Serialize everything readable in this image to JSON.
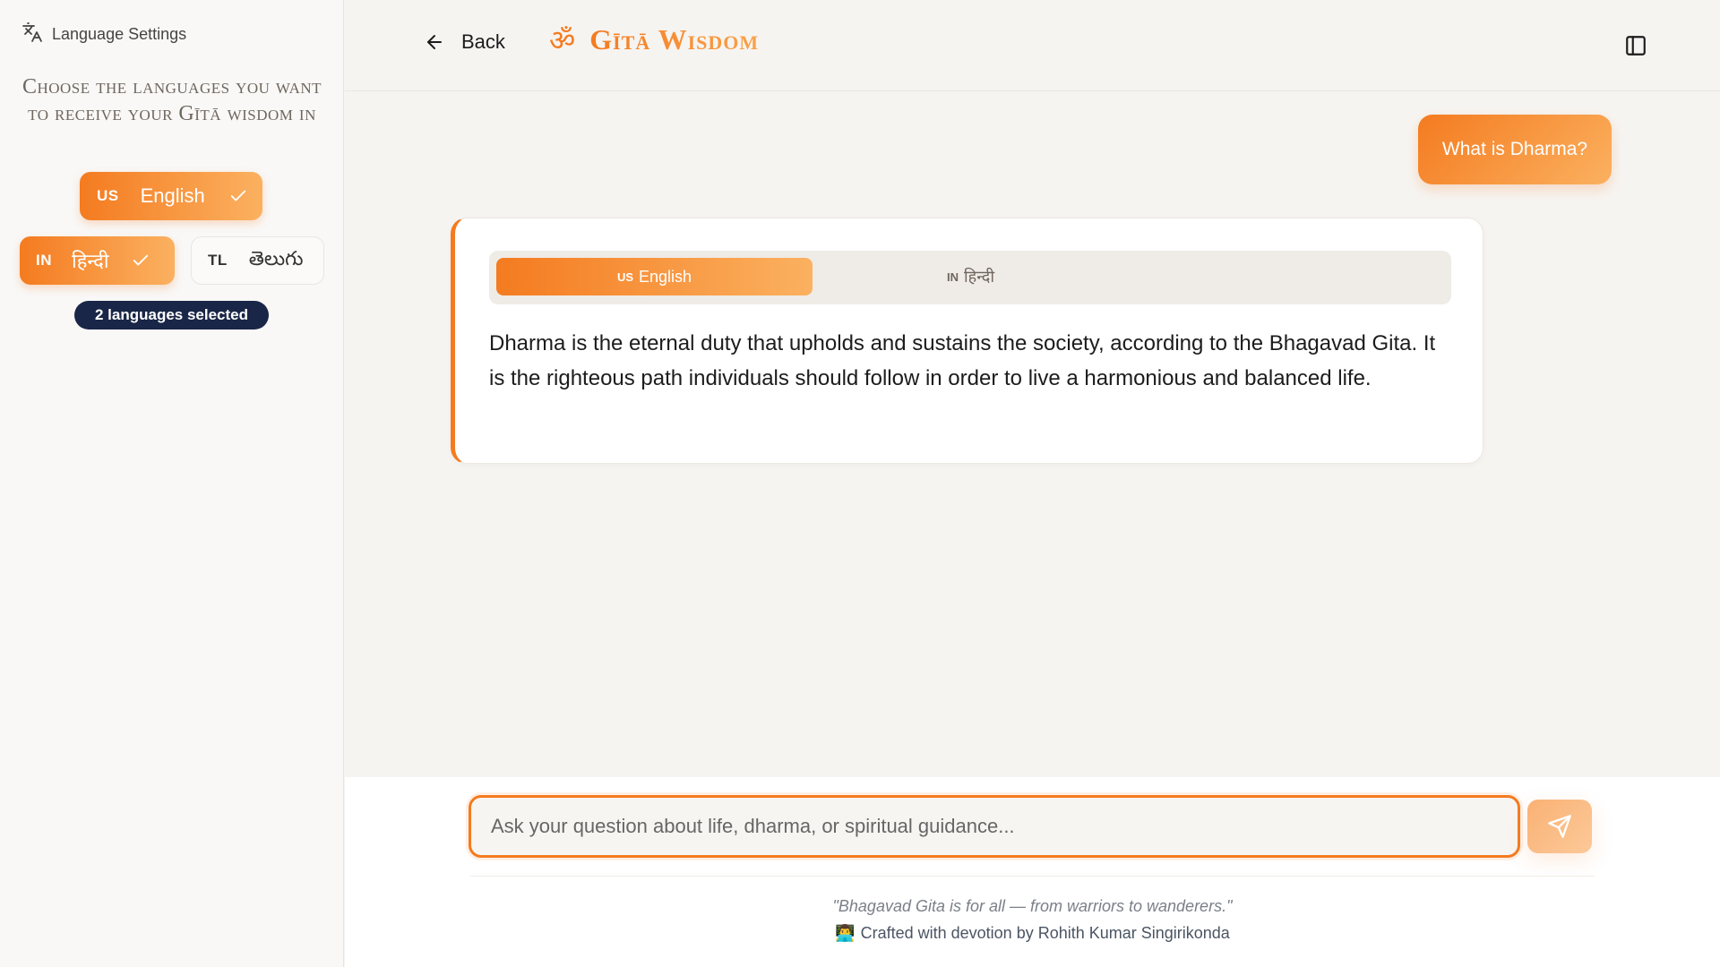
{
  "sidebar": {
    "heading": "Language Settings",
    "title": "Choose the languages you want to receive your Gītā wisdom in",
    "languages": [
      {
        "code": "US",
        "name": "English",
        "selected": true
      },
      {
        "code": "IN",
        "name": "हिन्दी",
        "selected": true
      },
      {
        "code": "TL",
        "name": "తెలుగు",
        "selected": false
      }
    ],
    "selected_count": "2 languages selected"
  },
  "header": {
    "back_label": "Back",
    "brand_symbol": "ॐ",
    "brand_title": "Gītā Wisdom"
  },
  "chat": {
    "user_message": "What is Dharma?",
    "answer": {
      "tabs": [
        {
          "code": "US",
          "label": "English",
          "active": true
        },
        {
          "code": "IN",
          "label": "हिन्दी",
          "active": false
        }
      ],
      "text": "Dharma is the eternal duty that upholds and sustains the society, according to the Bhagavad Gita. It is the righteous path individuals should follow in order to live a harmonious and balanced life."
    }
  },
  "composer": {
    "placeholder": "Ask your question about life, dharma, or spiritual guidance...",
    "value": ""
  },
  "footer": {
    "quote": "\"Bhagavad Gita is for all — from warriors to wanderers.\"",
    "credit_emoji": "👨‍💻",
    "credit": "Crafted with devotion by Rohith Kumar Singirikonda"
  },
  "colors": {
    "accent": "#f47b20",
    "accent_light": "#fbb160",
    "badge_bg": "#1a2647"
  },
  "icons": {
    "sidebar_heading": "translate-icon",
    "back": "arrow-left-icon",
    "panel": "panel-left-icon",
    "send": "send-icon",
    "check": "check-icon"
  }
}
